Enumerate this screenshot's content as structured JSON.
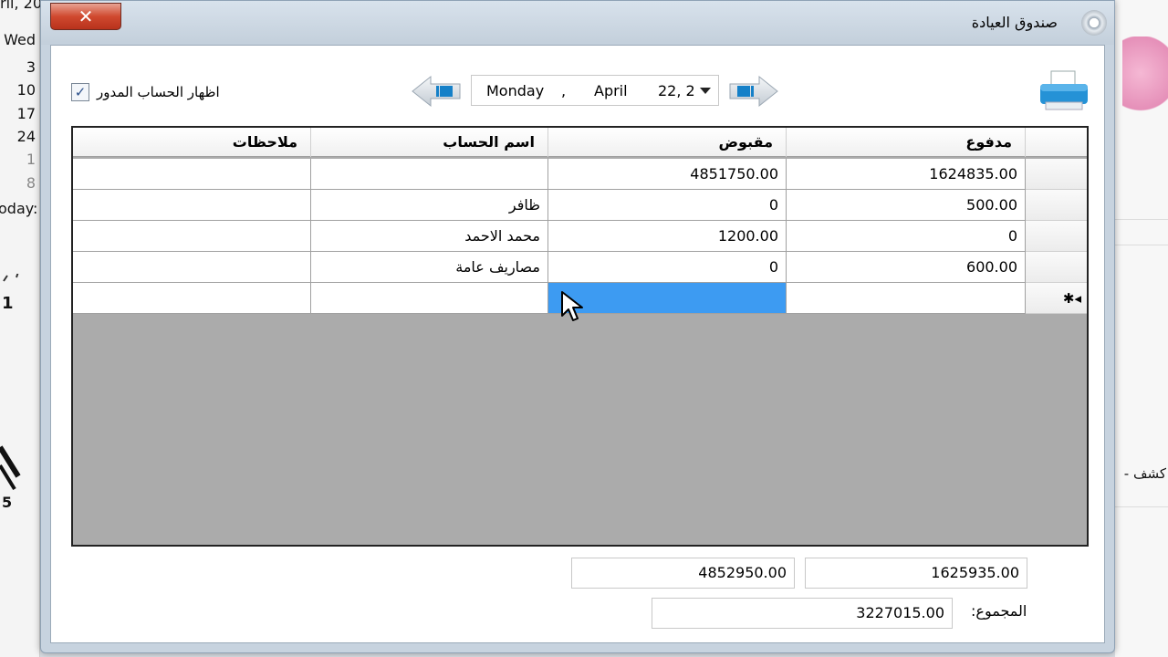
{
  "background": {
    "calendar": {
      "header": "ril, 20",
      "weekday": "Wed",
      "dates": [
        "3",
        "10",
        "17",
        "24",
        "1",
        "8"
      ],
      "today_label": "oday:"
    },
    "right_text": "كشف -"
  },
  "window": {
    "title": "صندوق العيادة",
    "close_label": "✕"
  },
  "toolbar": {
    "show_rotated_label": "اظهار الحساب المدور",
    "show_rotated_checked": true,
    "checkbox_mark": "✓",
    "date": {
      "day": "Monday",
      "comma": ",",
      "month": "April",
      "date": "22, 2"
    },
    "prev_icon": "left-arrow-icon",
    "next_icon": "right-arrow-icon",
    "print_icon": "printer-icon"
  },
  "grid": {
    "columns": {
      "paid": "مدفوع",
      "received": "مقبوض",
      "account_name": "اسم الحساب",
      "notes": "ملاحظات"
    },
    "rows": [
      {
        "paid": "1624835.00",
        "received": "4851750.00",
        "account_name": "",
        "notes": ""
      },
      {
        "paid": "500.00",
        "received": "0",
        "account_name": "ظافر",
        "notes": ""
      },
      {
        "paid": "0",
        "received": "1200.00",
        "account_name": "محمد الاحمد",
        "notes": ""
      },
      {
        "paid": "600.00",
        "received": "0",
        "account_name": "مصاريف عامة",
        "notes": ""
      }
    ],
    "new_row_marker": "✱◂"
  },
  "totals": {
    "paid_total": "1625935.00",
    "received_total": "4852950.00",
    "sum_label": "المجموع:",
    "sum_value": "3227015.00"
  },
  "colors": {
    "selection": "#3d9bf2",
    "grid_empty": "#ababab",
    "close_button": "#c9422a"
  }
}
